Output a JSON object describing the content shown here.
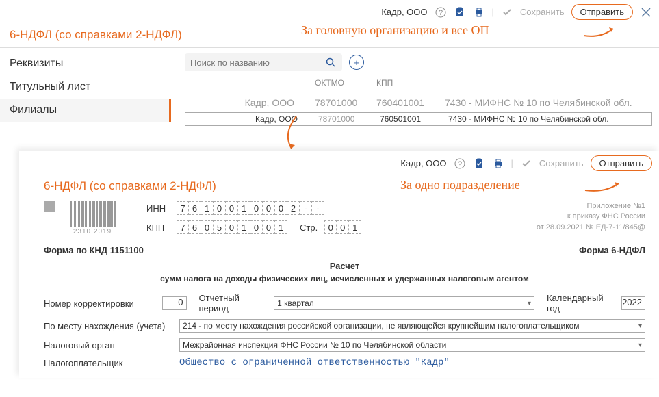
{
  "header": {
    "org": "Кадр, ООО",
    "save": "Сохранить",
    "send": "Отправить"
  },
  "annotation1": "За головную организацию и все ОП",
  "annotation2": "За одно подразделение",
  "page_title": "6-НДФЛ (со справками 2-НДФЛ)",
  "sidebar": {
    "items": [
      {
        "label": "Реквизиты"
      },
      {
        "label": "Титульный лист"
      },
      {
        "label": "Филиалы"
      }
    ]
  },
  "search": {
    "placeholder": "Поиск по названию"
  },
  "columns": {
    "oktmo": "ОКТМО",
    "kpp": "КПП"
  },
  "branches": [
    {
      "name": "Кадр, ООО",
      "oktmo": "78701000",
      "kpp": "760401001",
      "desc": "7430 - МИФНС № 10 по Челябинской обл."
    },
    {
      "name": "Кадр, ООО",
      "oktmo": "78701000",
      "kpp": "760501001",
      "desc": "7430 - МИФНС № 10 по Челябинской обл."
    }
  ],
  "form": {
    "inn_label": "ИНН",
    "kpp_label": "КПП",
    "page_label": "Стр.",
    "inn": [
      "7",
      "6",
      "1",
      "0",
      "0",
      "1",
      "0",
      "0",
      "0",
      "2",
      "-",
      "-"
    ],
    "kpp": [
      "7",
      "6",
      "0",
      "5",
      "0",
      "1",
      "0",
      "0",
      "1"
    ],
    "page": [
      "0",
      "0",
      "1"
    ],
    "barcode_num": "2310 2019",
    "ref": {
      "l1": "Приложение №1",
      "l2": "к приказу ФНС России",
      "l3": "от 28.09.2021 № ЕД-7-11/845@"
    },
    "knd": "Форма по КНД 1151100",
    "form_name": "Форма 6-НДФЛ",
    "title": "Расчет",
    "subtitle": "сумм налога на доходы физических лиц, исчисленных и удержанных налоговым агентом",
    "corr_label": "Номер корректировки",
    "corr_value": "0",
    "period_label": "Отчетный период",
    "period_value": "1 квартал",
    "year_label": "Календарный год",
    "year_value": "2022",
    "loc_label": "По месту нахождения (учета)",
    "loc_value": "214 - по месту нахождения российской организации, не являющейся крупнейшим налогоплательщиком",
    "tax_label": "Налоговый орган",
    "tax_value": "Межрайонная инспекция ФНС России № 10 по Челябинской области",
    "payer_label": "Налогоплательщик",
    "payer_value": "Общество с ограниченной ответственностью \"Кадр\""
  }
}
